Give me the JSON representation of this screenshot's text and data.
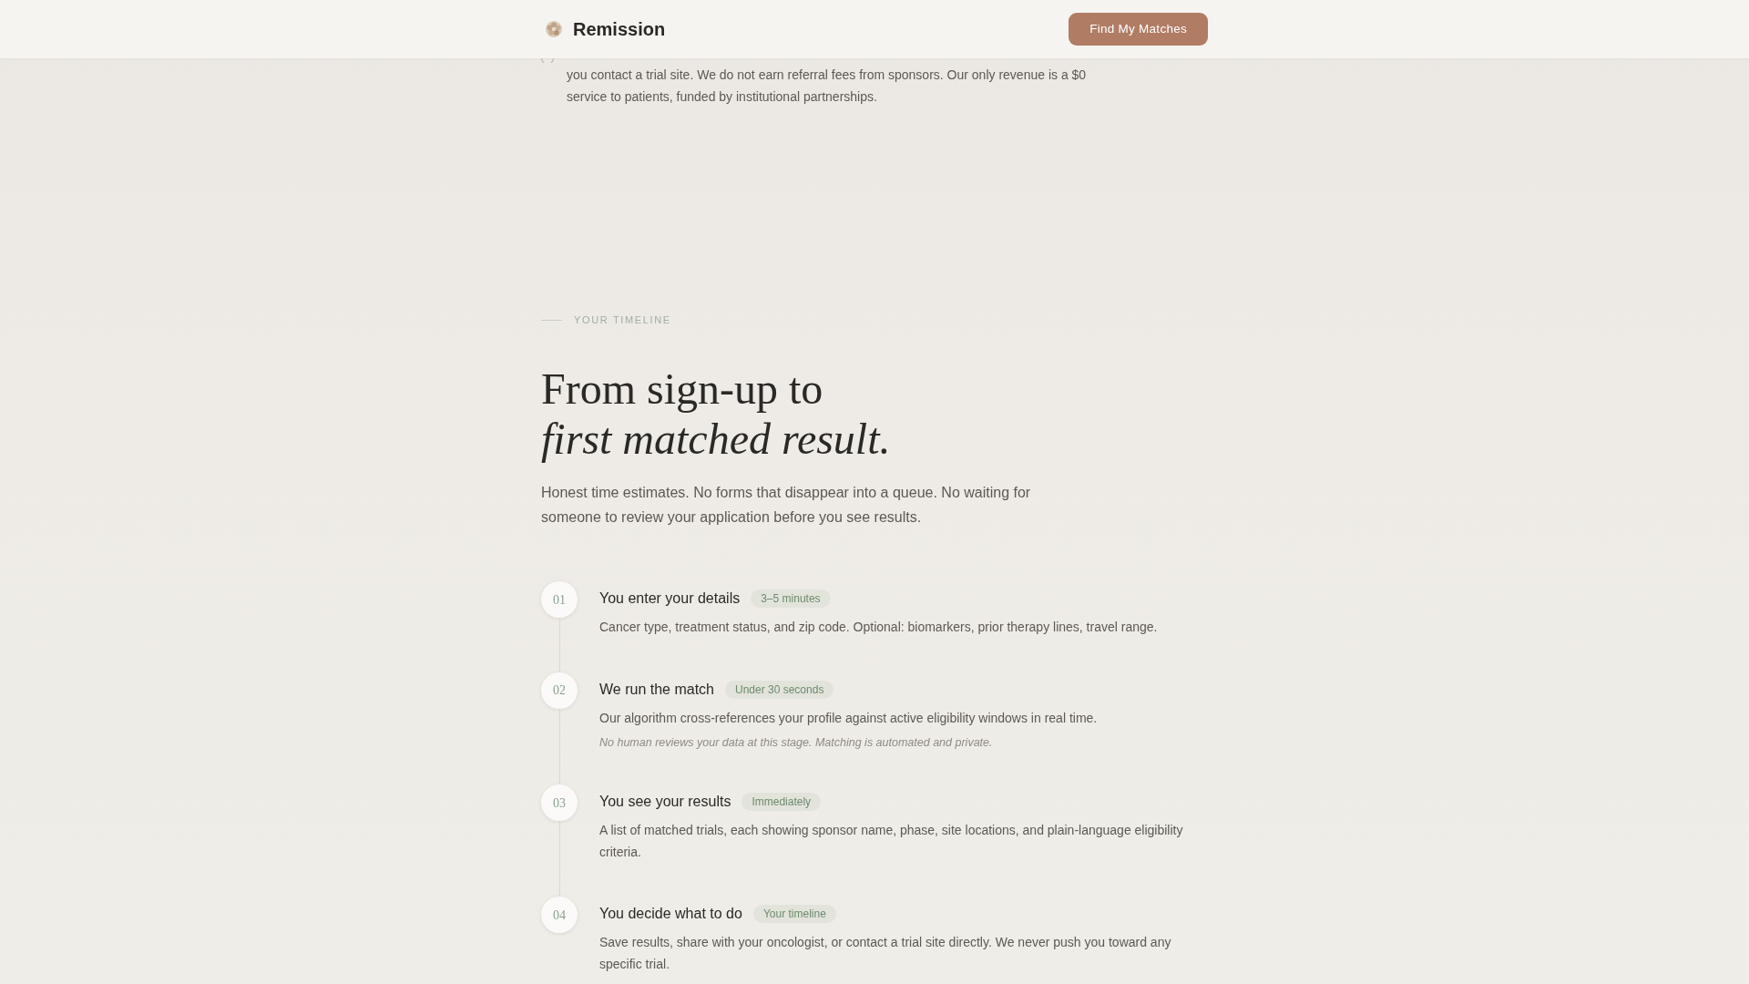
{
  "header": {
    "brand": "Remission",
    "cta": "Find My Matches"
  },
  "disclosure": {
    "text": "you contact a trial site. We do not earn referral fees from sponsors. Our only revenue is a $0 service to patients, funded by institutional partnerships."
  },
  "timeline": {
    "eyebrow": "YOUR TIMELINE",
    "heading": {
      "line": "From sign-up to",
      "emphasis": "first matched result."
    },
    "intro": "Honest time estimates. No forms that disappear into a queue. No waiting for someone to review your application before you see results.",
    "steps": [
      {
        "number": "01",
        "title": "You enter your details",
        "duration": "3–5 minutes",
        "description": "Cancer type, treatment status, and zip code. Optional: biomarkers, prior therapy lines, travel range."
      },
      {
        "number": "02",
        "title": "We run the match",
        "duration": "Under 30 seconds",
        "description": "Our algorithm cross-references your profile against active eligibility windows in real time.",
        "note": "No human reviews your data at this stage. Matching is automated and private."
      },
      {
        "number": "03",
        "title": "You see your results",
        "duration": "Immediately",
        "description": "A list of matched trials, each showing sponsor name, phase, site locations, and plain-language eligibility criteria."
      },
      {
        "number": "04",
        "title": "You decide what to do",
        "duration": "Your timeline",
        "description": "Save results, share with your oncologist, or contact a trial site directly. We never push you toward any specific trial."
      }
    ]
  }
}
